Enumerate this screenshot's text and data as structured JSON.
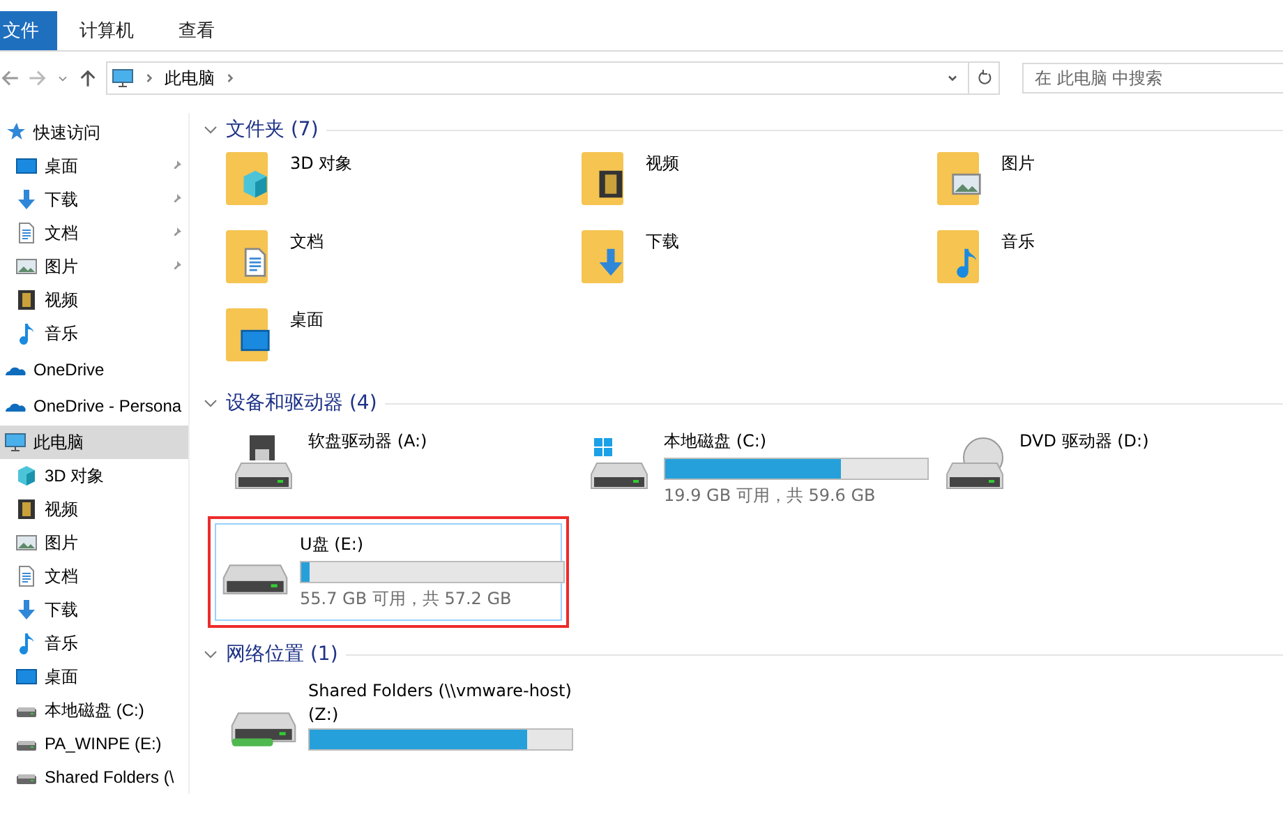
{
  "ribbon": {
    "tabs": [
      {
        "label": "文件",
        "selected": true
      },
      {
        "label": "计算机",
        "selected": false
      },
      {
        "label": "查看",
        "selected": false
      }
    ]
  },
  "address_bar": {
    "path": "此电脑",
    "search_placeholder": "在 此电脑 中搜索"
  },
  "sidebar": {
    "items": [
      {
        "label": "快速访问",
        "kind": "star",
        "selected": false,
        "children": [
          {
            "label": "桌面",
            "kind": "desktop",
            "pinned": true
          },
          {
            "label": "下载",
            "kind": "download",
            "pinned": true
          },
          {
            "label": "文档",
            "kind": "document",
            "pinned": true
          },
          {
            "label": "图片",
            "kind": "picture",
            "pinned": true
          },
          {
            "label": "视频",
            "kind": "video",
            "pinned": false
          },
          {
            "label": "音乐",
            "kind": "music",
            "pinned": false
          }
        ]
      },
      {
        "label": "OneDrive",
        "kind": "cloud",
        "selected": false
      },
      {
        "label": "OneDrive - Persona",
        "kind": "cloud",
        "selected": false
      },
      {
        "label": "此电脑",
        "kind": "computer",
        "selected": true,
        "children": [
          {
            "label": "3D 对象",
            "kind": "cube",
            "pinned": false
          },
          {
            "label": "视频",
            "kind": "video",
            "pinned": false
          },
          {
            "label": "图片",
            "kind": "picture",
            "pinned": false
          },
          {
            "label": "文档",
            "kind": "document",
            "pinned": false
          },
          {
            "label": "下载",
            "kind": "download",
            "pinned": false
          },
          {
            "label": "音乐",
            "kind": "music",
            "pinned": false
          },
          {
            "label": "桌面",
            "kind": "desktop",
            "pinned": false
          },
          {
            "label": "本地磁盘 (C:)",
            "kind": "windrive",
            "pinned": false
          },
          {
            "label": "PA_WINPE (E:)",
            "kind": "drive",
            "pinned": false
          },
          {
            "label": "Shared Folders (\\",
            "kind": "netdrive",
            "pinned": false
          }
        ]
      }
    ]
  },
  "groups": [
    {
      "title": "文件夹 (7)",
      "expanded": true,
      "items": [
        {
          "label": "3D 对象",
          "kind": "cube"
        },
        {
          "label": "视频",
          "kind": "video"
        },
        {
          "label": "图片",
          "kind": "picture"
        },
        {
          "label": "文档",
          "kind": "document"
        },
        {
          "label": "下载",
          "kind": "download"
        },
        {
          "label": "音乐",
          "kind": "music"
        },
        {
          "label": "桌面",
          "kind": "desktop"
        }
      ]
    },
    {
      "title": "设备和驱动器 (4)",
      "expanded": true,
      "items": [
        {
          "label": "软盘驱动器 (A:)",
          "kind": "floppy",
          "selected": false,
          "highlighted": false
        },
        {
          "label": "本地磁盘 (C:)",
          "kind": "windrive",
          "level": 0.67,
          "space": "19.9 GB 可用，共 59.6 GB",
          "selected": false,
          "highlighted": false
        },
        {
          "label": "DVD 驱动器 (D:)",
          "kind": "dvd",
          "selected": false,
          "highlighted": false
        },
        {
          "label": "U盘 (E:)",
          "kind": "drive",
          "level": 0.03,
          "space": "55.7 GB 可用，共 57.2 GB",
          "selected": true,
          "highlighted": true
        }
      ]
    },
    {
      "title": "网络位置 (1)",
      "expanded": true,
      "items": [
        {
          "label": "Shared Folders (\\\\vmware-host)",
          "label_line_2": "(Z:)",
          "kind": "netdrive",
          "level": 0.83,
          "selected": false,
          "highlighted": false
        }
      ]
    }
  ]
}
